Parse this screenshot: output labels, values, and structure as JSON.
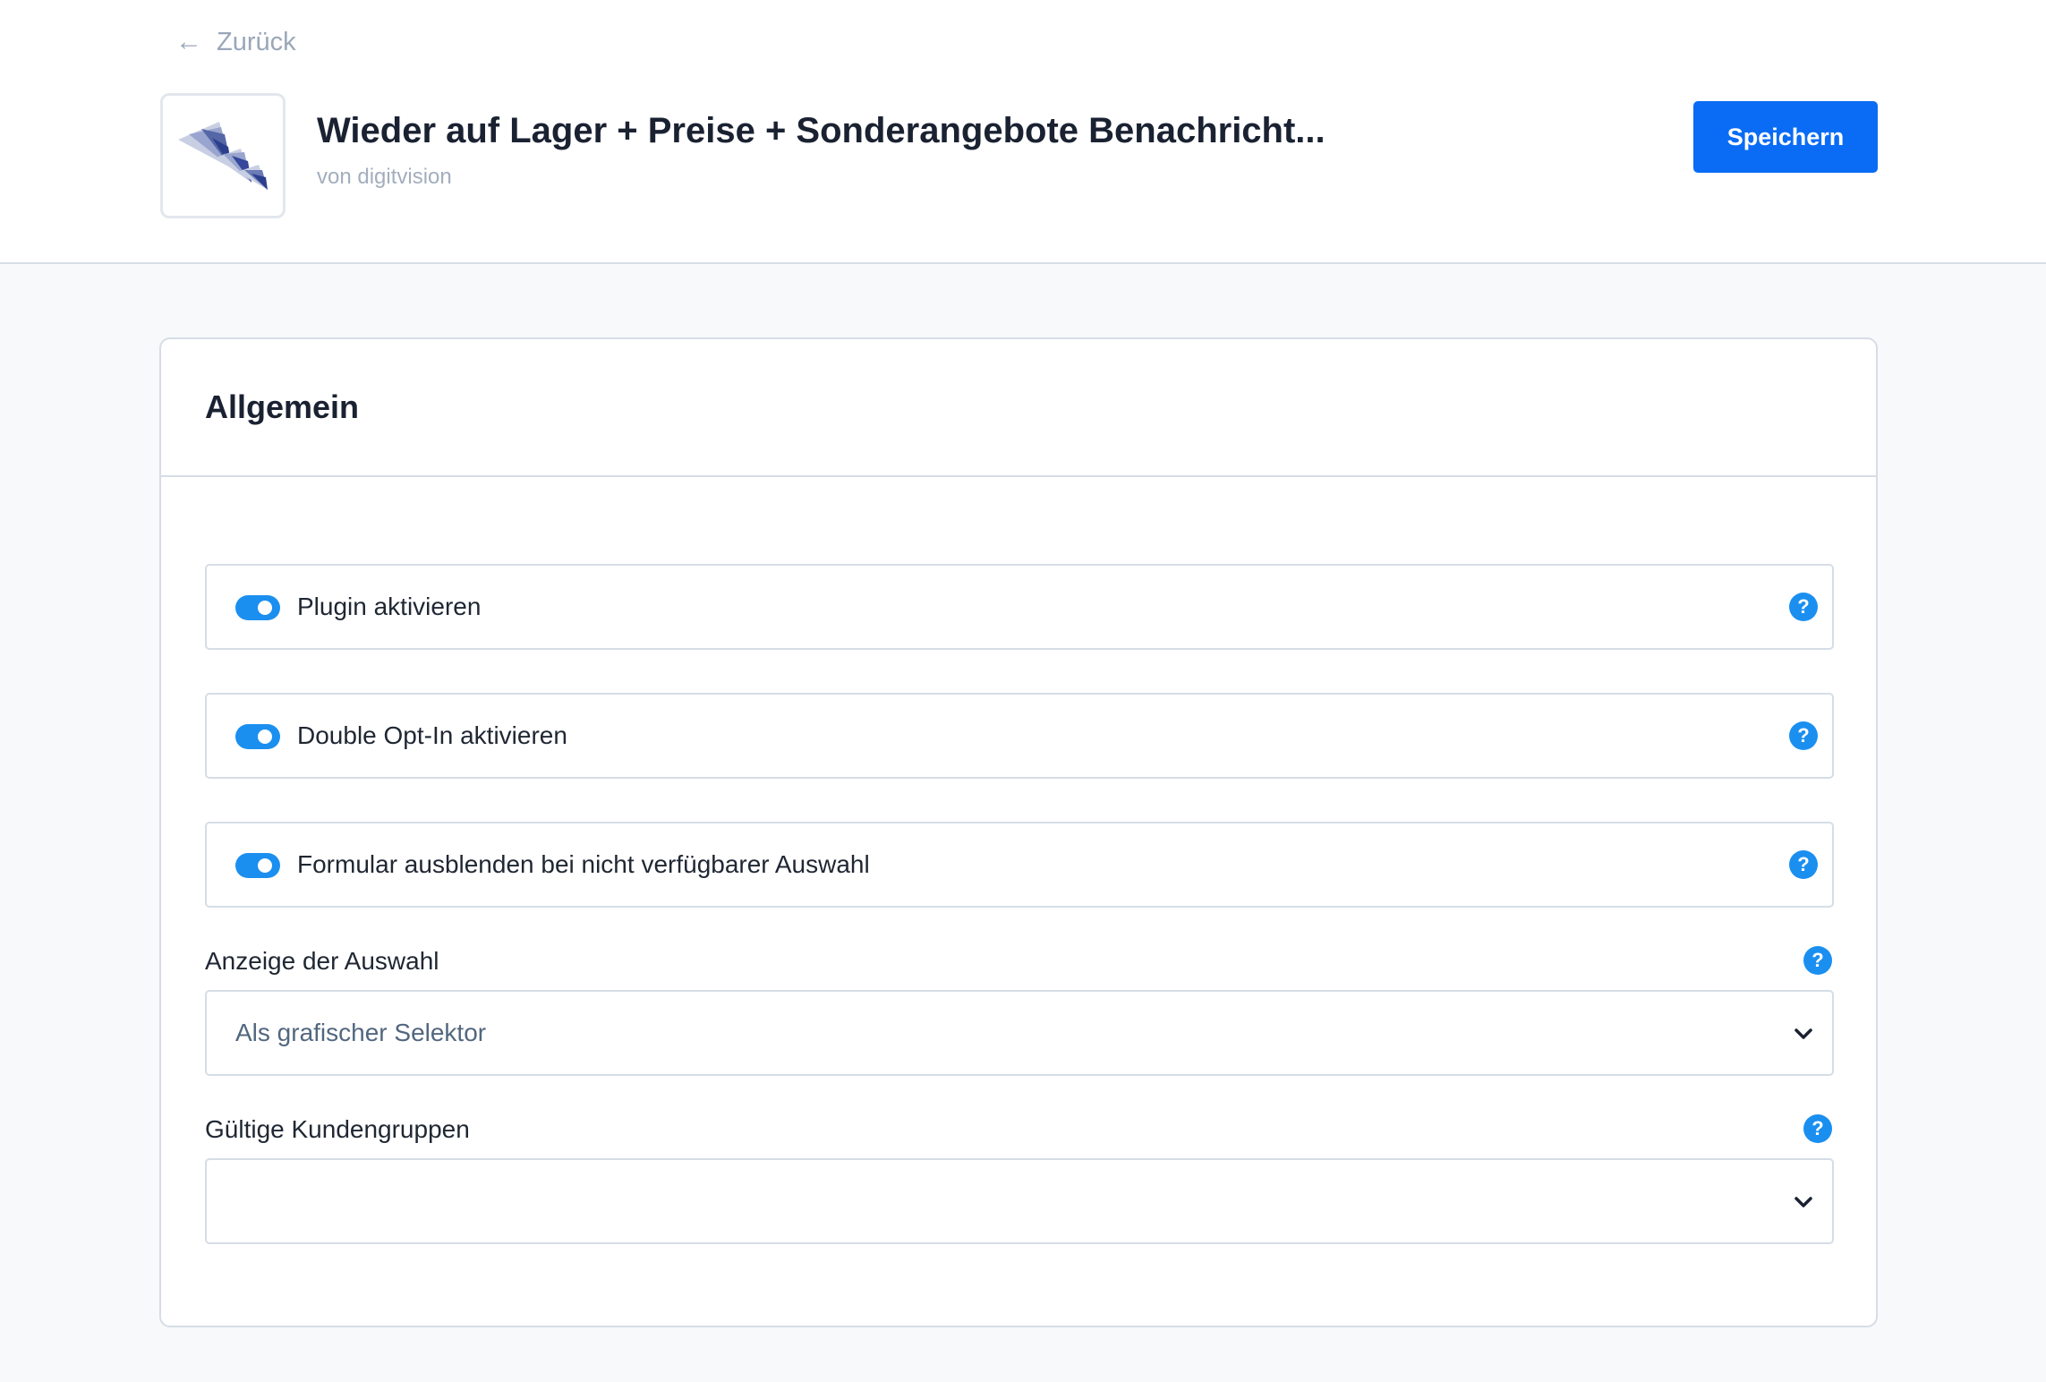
{
  "header": {
    "back_label": "Zurück",
    "title": "Wieder auf Lager + Preise + Sonderangebote Benachricht...",
    "vendor": "von digitvision",
    "save_label": "Speichern"
  },
  "card": {
    "title": "Allgemein",
    "toggles": [
      {
        "label": "Plugin aktivieren",
        "enabled": true
      },
      {
        "label": "Double Opt-In aktivieren",
        "enabled": true
      },
      {
        "label": "Formular ausblenden bei nicht verfügbarer Auswahl",
        "enabled": true
      }
    ],
    "fields": [
      {
        "label": "Anzeige der Auswahl",
        "value": "Als grafischer Selektor"
      },
      {
        "label": "Gültige Kundengruppen",
        "value": ""
      }
    ]
  },
  "icons": {
    "back": "arrow-left-icon",
    "help": "question-circle-icon",
    "dropdown": "chevron-down-icon"
  },
  "colors": {
    "accent": "#0a6cf5",
    "toggle_on": "#1b8ff0",
    "help": "#1b8ff0"
  }
}
